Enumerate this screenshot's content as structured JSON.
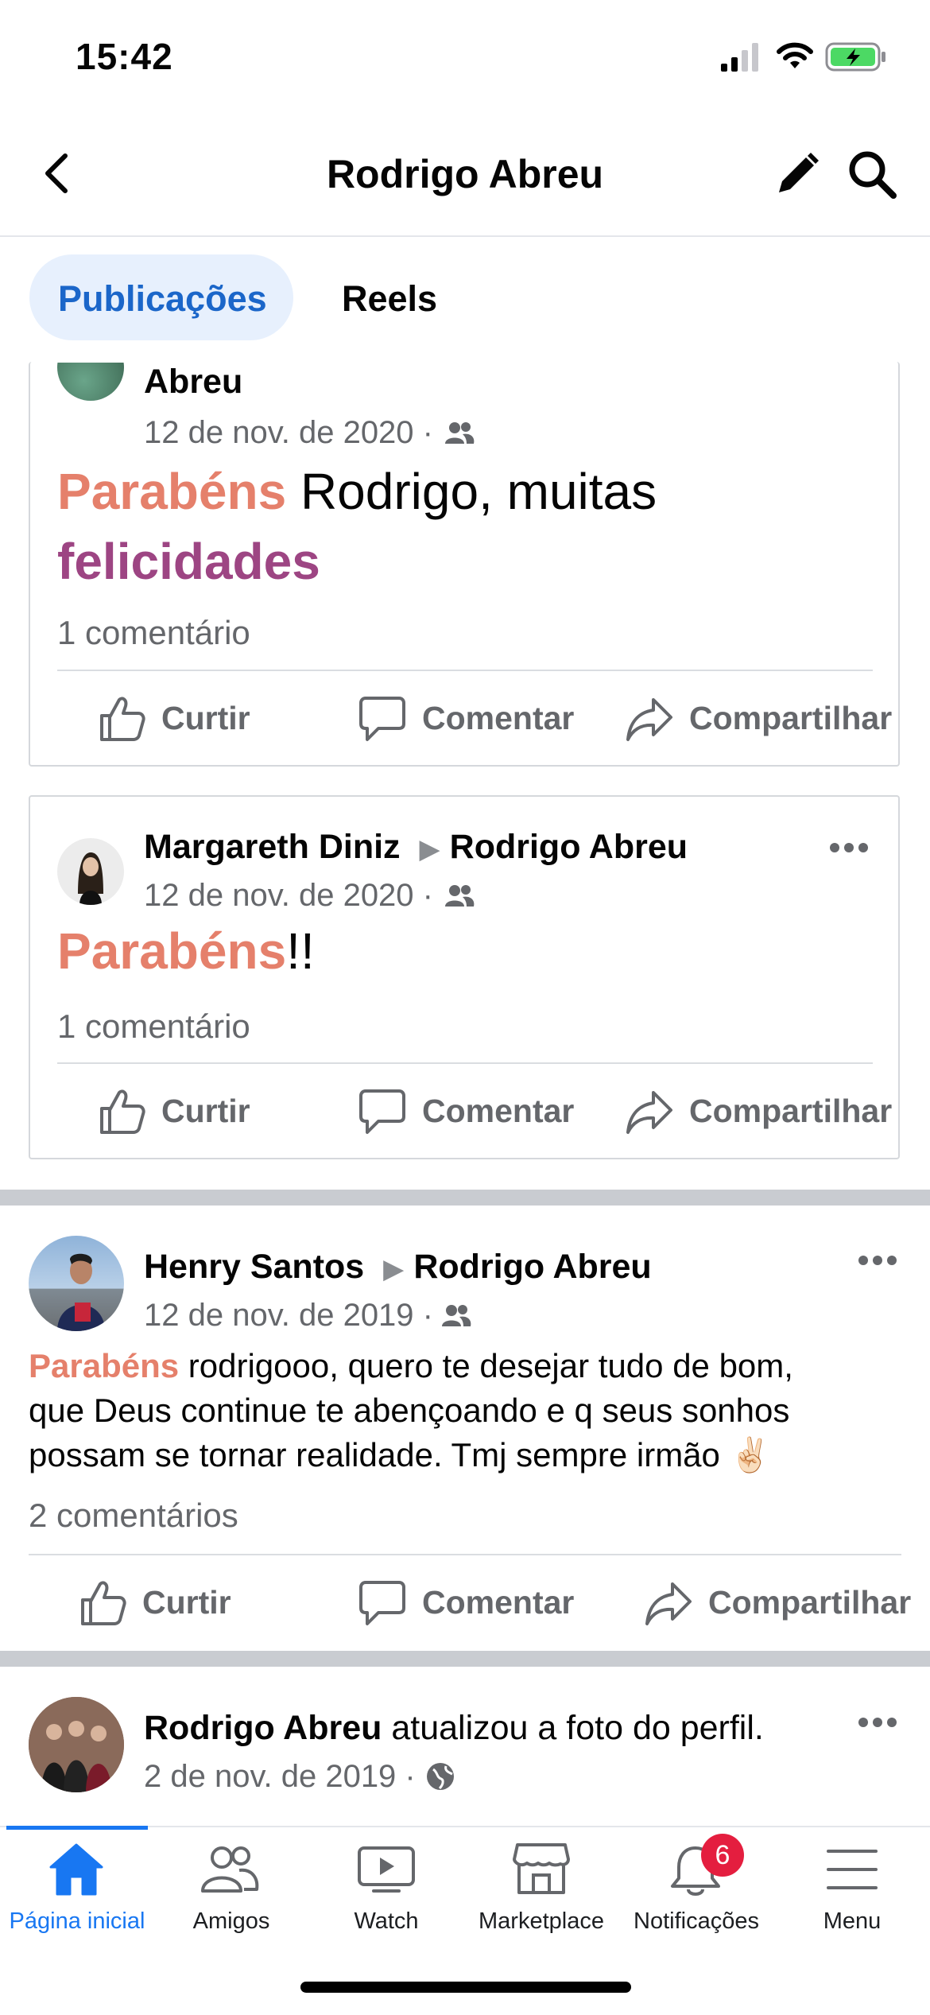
{
  "status": {
    "time": "15:42"
  },
  "header": {
    "title": "Rodrigo Abreu"
  },
  "tabs": [
    {
      "label": "Publicações",
      "active": true
    },
    {
      "label": "Reels",
      "active": false
    }
  ],
  "posts": [
    {
      "author_partial": "Abreu",
      "date": "12 de nov. de 2020 ·",
      "audience_icon": "friends-icon",
      "text": {
        "w1": "Parabéns",
        "w2": " Rodrigo, muitas",
        "w3": "felicidades"
      },
      "comments": "1 comentário",
      "actions": {
        "like": "Curtir",
        "comment": "Comentar",
        "share": "Compartilhar"
      }
    },
    {
      "author": "Margareth Diniz",
      "target": "Rodrigo Abreu",
      "date": "12 de nov. de 2020 ·",
      "audience_icon": "friends-icon",
      "text": {
        "w1": "Parabéns",
        "w2": "!!"
      },
      "comments": "1 comentário",
      "actions": {
        "like": "Curtir",
        "comment": "Comentar",
        "share": "Compartilhar"
      }
    },
    {
      "author": "Henry Santos",
      "target": "Rodrigo Abreu",
      "date": "12 de nov. de 2019 ·",
      "audience_icon": "friends-icon",
      "text": {
        "w1": "Parabéns",
        "l1": " rodrigooo, quero te desejar tudo de bom,",
        "l2": "que Deus continue te abençoando e q seus sonhos",
        "l3": "possam se tornar realidade. Tmj sempre irmão ✌🏻"
      },
      "comments": "2 comentários",
      "actions": {
        "like": "Curtir",
        "comment": "Comentar",
        "share": "Compartilhar"
      }
    },
    {
      "author": "Rodrigo Abreu",
      "action_text": " atualizou a foto do perfil.",
      "date": "2 de nov. de 2019 ·",
      "audience_icon": "globe-icon"
    }
  ],
  "bottom_nav": [
    {
      "label": "Página inicial",
      "icon": "home-icon",
      "active": true
    },
    {
      "label": "Amigos",
      "icon": "friends-icon"
    },
    {
      "label": "Watch",
      "icon": "watch-icon"
    },
    {
      "label": "Marketplace",
      "icon": "marketplace-icon"
    },
    {
      "label": "Notificações",
      "icon": "bell-icon",
      "badge": "6"
    },
    {
      "label": "Menu",
      "icon": "menu-icon"
    }
  ],
  "colors": {
    "accent": "#1877f2",
    "tab_bg": "#e7f0fd",
    "orange": "#e5806b",
    "purple": "#9d4583",
    "badge": "#e41e3f"
  }
}
